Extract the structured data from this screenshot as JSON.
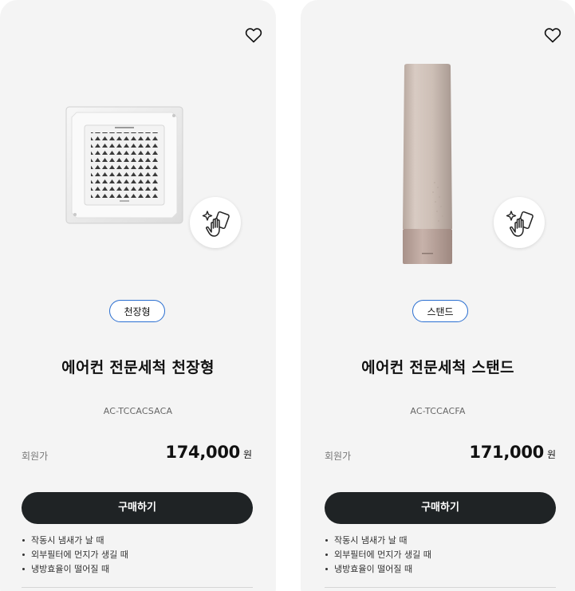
{
  "products": [
    {
      "type_chip": "천장형",
      "title": "에어컨 전문세척 천장형",
      "model": "AC-TCCACSACA",
      "price_label": "회원가",
      "price": "174,000",
      "currency": "원",
      "buy_label": "구매하기",
      "features": [
        "작동시 냄새가 날 때",
        "외부필터에 먼지가 생길 때",
        "냉방효율이 떨어질 때"
      ]
    },
    {
      "type_chip": "스탠드",
      "title": "에어컨 전문세척 스탠드",
      "model": "AC-TCCACFA",
      "price_label": "회원가",
      "price": "171,000",
      "currency": "원",
      "buy_label": "구매하기",
      "features": [
        "작동시 냄새가 날 때",
        "외부필터에 먼지가 생길 때",
        "냉방효율이 떨어질 때"
      ]
    }
  ],
  "colors": {
    "card_bg": "#f4f4f4",
    "chip_border": "#2b6fd1",
    "button_bg": "#1f2325",
    "button_text": "#ffffff"
  },
  "icons": {
    "wishlist": "heart-outline-icon",
    "cleaning": "hand-wipe-sparkle-icon"
  }
}
